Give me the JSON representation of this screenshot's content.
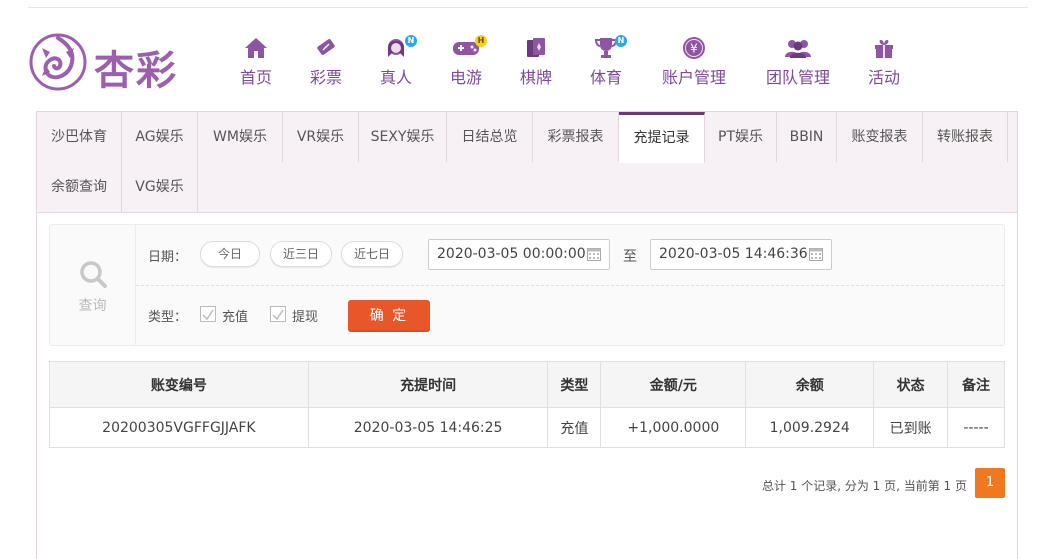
{
  "header": {
    "logo_text": "杏彩",
    "nav": [
      {
        "label": "首页",
        "icon": "home-icon"
      },
      {
        "label": "彩票",
        "icon": "lottery-ticket-icon"
      },
      {
        "label": "真人",
        "icon": "live-dealer-icon",
        "badge": "N"
      },
      {
        "label": "电游",
        "icon": "gamepad-icon",
        "badge": "H"
      },
      {
        "label": "棋牌",
        "icon": "cards-icon"
      },
      {
        "label": "体育",
        "icon": "trophy-icon",
        "badge": "N"
      },
      {
        "label": "账户管理",
        "icon": "yen-coin-icon"
      },
      {
        "label": "团队管理",
        "icon": "team-icon"
      },
      {
        "label": "活动",
        "icon": "gift-icon"
      }
    ]
  },
  "tabs": [
    "沙巴体育",
    "AG娱乐",
    "WM娱乐",
    "VR娱乐",
    "SEXY娱乐",
    "日结总览",
    "彩票报表",
    "充提记录",
    "PT娱乐",
    "BBIN",
    "账变报表",
    "转账报表",
    "余额查询",
    "VG娱乐"
  ],
  "active_tab": "充提记录",
  "search": {
    "side_label": "查询",
    "date_label": "日期：",
    "quick_today": "今日",
    "quick_3days": "近三日",
    "quick_7days": "近七日",
    "date_from": "2020-03-05 00:00:00",
    "date_sep": "至",
    "date_to": "2020-03-05 14:46:36",
    "type_label": "类型：",
    "type_deposit": "充值",
    "type_withdraw": "提现",
    "confirm": "确 定"
  },
  "table": {
    "headers": [
      "账变编号",
      "充提时间",
      "类型",
      "金额/元",
      "余额",
      "状态",
      "备注"
    ],
    "rows": [
      [
        "20200305VGFFGJJAFK",
        "2020-03-05 14:46:25",
        "充值",
        "+1,000.0000",
        "1,009.2924",
        "已到账",
        "-----"
      ]
    ]
  },
  "pager": {
    "info": "总计 1 个记录, 分为 1 页, 当前第 1 页",
    "current": "1"
  },
  "colors": {
    "brand_purple": "#7d4b9a",
    "confirm_orange": "#e8572a",
    "amount_red": "#d7281b",
    "status_green": "#3a9a28",
    "page_orange": "#f0781e"
  }
}
